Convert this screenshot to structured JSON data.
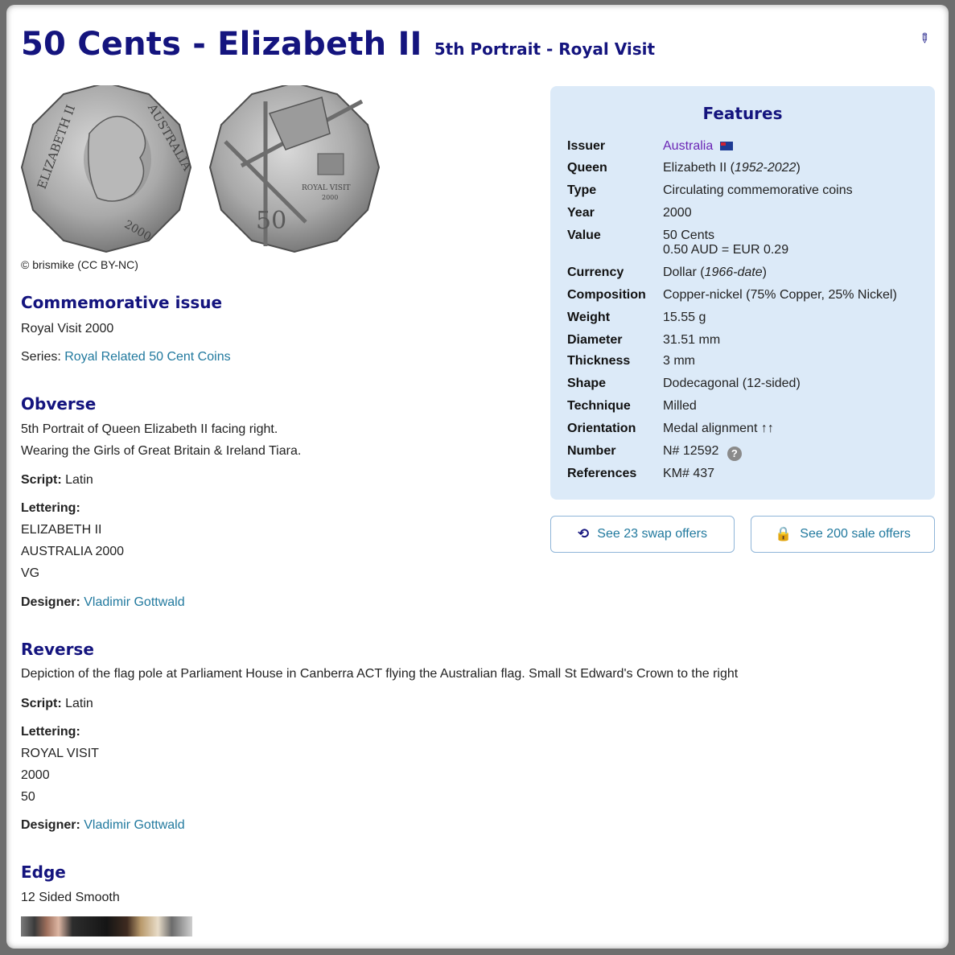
{
  "header": {
    "title": "50 Cents - Elizabeth II",
    "subtitle": "5th Portrait - Royal Visit"
  },
  "images": {
    "copyright": "© brismike (CC BY-NC)",
    "obverse_text": [
      "ELIZABETH II",
      "AUSTRALIA",
      "2000"
    ],
    "reverse_text": [
      "ROYAL VISIT",
      "2000",
      "50"
    ]
  },
  "commemorative": {
    "heading": "Commemorative issue",
    "name": "Royal Visit 2000",
    "series_label": "Series:",
    "series_value": "Royal Related 50 Cent Coins"
  },
  "obverse": {
    "heading": "Obverse",
    "desc1": "5th Portrait of Queen Elizabeth II facing right.",
    "desc2": "Wearing the Girls of Great Britain & Ireland Tiara.",
    "script_label": "Script:",
    "script_value": "Latin",
    "lettering_label": "Lettering:",
    "lettering": [
      "ELIZABETH II",
      "AUSTRALIA 2000",
      "VG"
    ],
    "designer_label": "Designer:",
    "designer_value": "Vladimir Gottwald"
  },
  "reverse": {
    "heading": "Reverse",
    "desc": "Depiction of the flag pole at Parliament House in Canberra ACT flying the Australian flag. Small St Edward's Crown to the right",
    "script_label": "Script:",
    "script_value": "Latin",
    "lettering_label": "Lettering:",
    "lettering": [
      "ROYAL VISIT",
      "2000",
      "50"
    ],
    "designer_label": "Designer:",
    "designer_value": "Vladimir Gottwald"
  },
  "edge": {
    "heading": "Edge",
    "desc": "12 Sided Smooth"
  },
  "features": {
    "heading": "Features",
    "issuer_k": "Issuer",
    "issuer_v": "Australia",
    "queen_k": "Queen",
    "queen_v": "Elizabeth II (",
    "queen_years": "1952-2022",
    "queen_close": ")",
    "type_k": "Type",
    "type_v": "Circulating commemorative coins",
    "year_k": "Year",
    "year_v": "2000",
    "value_k": "Value",
    "value_v1": "50 Cents",
    "value_v2": "0.50 AUD = EUR 0.29",
    "currency_k": "Currency",
    "currency_v": "Dollar (",
    "currency_years": "1966-date",
    "currency_close": ")",
    "composition_k": "Composition",
    "composition_v": "Copper-nickel (75% Copper, 25% Nickel)",
    "weight_k": "Weight",
    "weight_v": "15.55 g",
    "diameter_k": "Diameter",
    "diameter_v": "31.51 mm",
    "thickness_k": "Thickness",
    "thickness_v": "3 mm",
    "shape_k": "Shape",
    "shape_v": "Dodecagonal (12-sided)",
    "technique_k": "Technique",
    "technique_v": "Milled",
    "orientation_k": "Orientation",
    "orientation_v": "Medal alignment ↑↑",
    "number_k": "Number",
    "number_v": "N# 12592",
    "references_k": "References",
    "references_v": "KM# 437"
  },
  "actions": {
    "swap_label": "See 23 swap offers",
    "sale_label": "See 200 sale offers"
  }
}
